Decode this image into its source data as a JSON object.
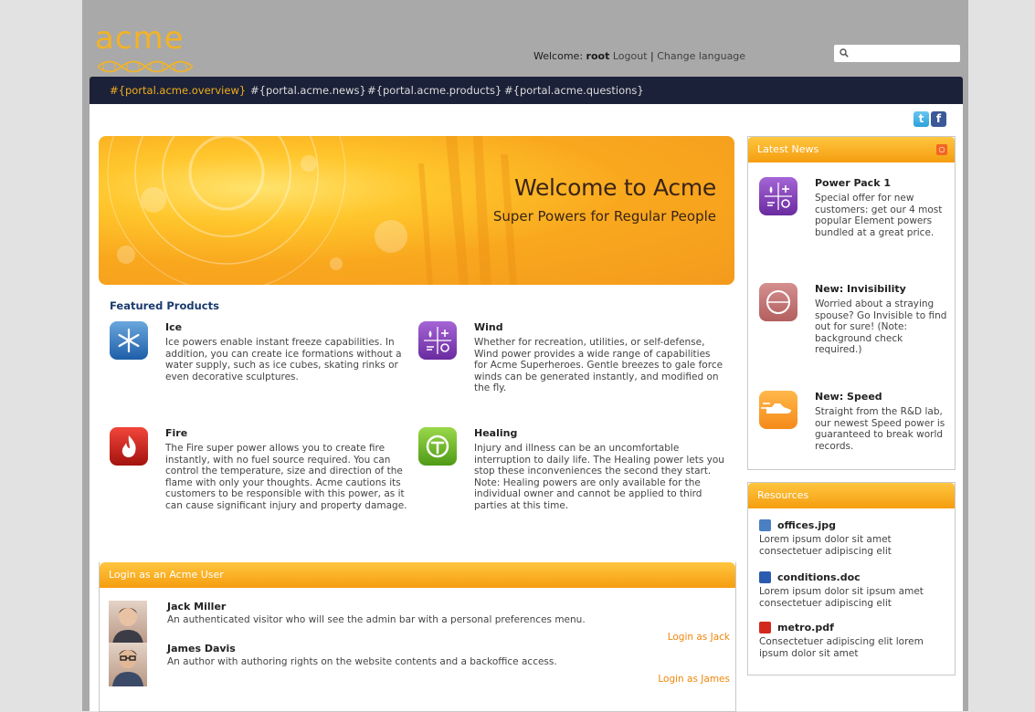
{
  "brand": {
    "logo_text": "acme"
  },
  "header": {
    "welcome_label": "Welcome:",
    "username": "root",
    "logout": "Logout",
    "separator": "|",
    "change_language": "Change language",
    "search_placeholder": ""
  },
  "nav": {
    "items": [
      "#{portal.acme.overview}",
      "#{portal.acme.news}",
      "#{portal.acme.products}",
      "#{portal.acme.questions}"
    ]
  },
  "social": {
    "twitter": "t",
    "facebook": "f"
  },
  "hero": {
    "title": "Welcome to Acme",
    "subtitle": "Super Powers for Regular People"
  },
  "featured": {
    "heading": "Featured Products",
    "products": [
      {
        "name": "Ice",
        "icon": "snowflake-icon",
        "desc": "Ice powers enable instant freeze capabilities. In addition, you can create ice formations without a water supply, such as ice cubes, skating rinks or even decorative sculptures."
      },
      {
        "name": "Wind",
        "icon": "element-grid-icon",
        "desc": "Whether for recreation, utilities, or self-defense, Wind power provides a wide range of capabilities for Acme Superheroes. Gentle breezes to gale force winds can be generated instantly, and modified on the fly."
      },
      {
        "name": "Fire",
        "icon": "flame-icon",
        "desc": "The Fire super power allows you to create fire instantly, with no fuel source required. You can control the temperature, size and direction of the flame with only your thoughts. Acme cautions its customers to be responsible with this power, as it can cause significant injury and property damage."
      },
      {
        "name": "Healing",
        "icon": "healing-icon",
        "desc": "Injury and illness can be an uncomfortable interruption to daily life. The Healing power lets you stop these inconveniences the second they start. Note: Healing powers are only available for the individual owner and cannot be applied to third parties at this time."
      }
    ]
  },
  "login": {
    "heading": "Login as an Acme User",
    "users": [
      {
        "name": "Jack Miller",
        "desc": "An authenticated visitor who will see the admin bar with a personal preferences menu.",
        "link": "Login as Jack"
      },
      {
        "name": "James Davis",
        "desc": "An author with authoring rights on the website contents and a backoffice access.",
        "link": "Login as James"
      }
    ]
  },
  "latest_news": {
    "heading": "Latest News",
    "items": [
      {
        "title": "Power Pack 1",
        "icon": "element-grid-icon",
        "desc": "Special offer for new customers: get our 4 most popular Element powers bundled at a great price."
      },
      {
        "title": "New: Invisibility",
        "icon": "invisibility-icon",
        "desc": "Worried about a straying spouse? Go Invisible to find out for sure! (Note: background check required.)"
      },
      {
        "title": "New: Speed",
        "icon": "speed-shoe-icon",
        "desc": "Straight from the R&D lab, our newest Speed power is guaranteed to break world records."
      }
    ]
  },
  "resources": {
    "heading": "Resources",
    "files": [
      {
        "name": "offices.jpg",
        "icon": "image-file-icon",
        "color": "#4a7fc1",
        "desc": "Lorem ipsum dolor sit amet consectetuer adipiscing elit"
      },
      {
        "name": "conditions.doc",
        "icon": "word-file-icon",
        "color": "#2b5bb0",
        "desc": "Lorem ipsum dolor sit ipsum amet consectetuer adipiscing elit"
      },
      {
        "name": "metro.pdf",
        "icon": "pdf-file-icon",
        "color": "#d3281e",
        "desc": "Consectetuer adipiscing elit lorem ipsum dolor sit amet"
      }
    ]
  }
}
